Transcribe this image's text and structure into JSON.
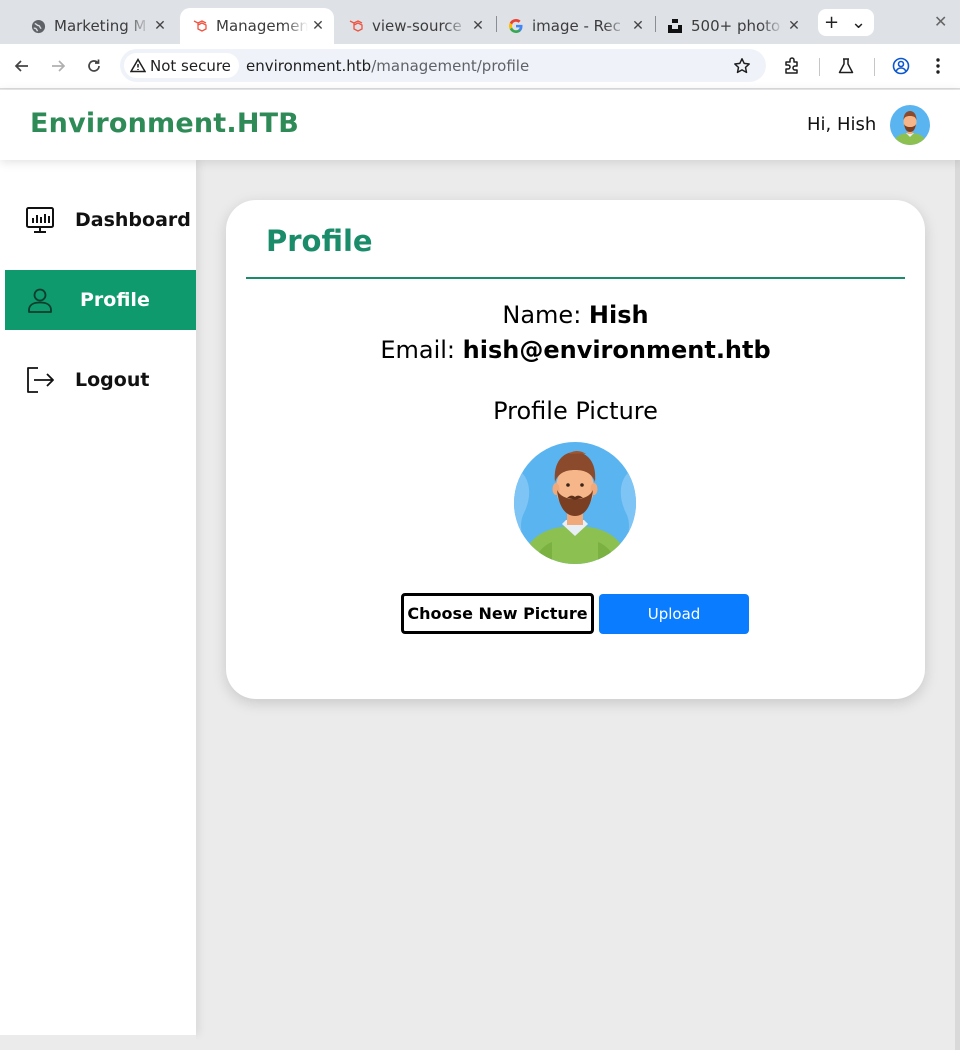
{
  "browser": {
    "tabs": [
      {
        "title": "Marketing M",
        "icon": "globe-icon"
      },
      {
        "title": "Managemen",
        "icon": "laravel-icon"
      },
      {
        "title": "view-source",
        "icon": "laravel-icon"
      },
      {
        "title": "image - Rec",
        "icon": "google-icon"
      },
      {
        "title": "500+ photo",
        "icon": "unsplash-icon"
      }
    ],
    "active_tab": 1,
    "security_label": "Not secure",
    "url_host": "environment.htb",
    "url_path": "/management/profile"
  },
  "header": {
    "brand": "Environment.HTB",
    "greeting": "Hi, Hish"
  },
  "sidebar": {
    "items": [
      {
        "label": "Dashboard",
        "icon": "dashboard-monitor-icon"
      },
      {
        "label": "Profile",
        "icon": "user-icon"
      },
      {
        "label": "Logout",
        "icon": "logout-icon"
      }
    ],
    "active_index": 1
  },
  "profile": {
    "title": "Profile",
    "name_label": "Name:",
    "name_value": "Hish",
    "email_label": "Email:",
    "email_value": "hish@environment.htb",
    "picture_label": "Profile Picture",
    "choose_button": "Choose New Picture",
    "upload_button": "Upload"
  },
  "colors": {
    "brand": "#2e8b57",
    "accent": "#0f9a6e",
    "upload": "#0a7cff"
  }
}
